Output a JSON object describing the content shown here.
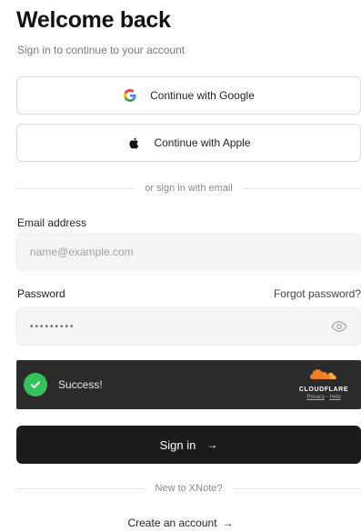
{
  "header": {
    "title": "Welcome back",
    "subtitle": "Sign in to continue to your account"
  },
  "oauth": {
    "google_label": "Continue with Google",
    "apple_label": "Continue with Apple"
  },
  "divider_email": "or sign in with email",
  "email": {
    "label": "Email address",
    "placeholder": "name@example.com",
    "value": ""
  },
  "password": {
    "label": "Password",
    "forgot_label": "Forgot password?",
    "masked_value": "•••••••••"
  },
  "captcha": {
    "status": "Success!",
    "provider": "CLOUDFLARE",
    "privacy": "Privacy",
    "separator": "·",
    "help": "Help",
    "status_color": "#34c25a"
  },
  "signin": {
    "label": "Sign in",
    "arrow": "→"
  },
  "divider_signup": "New to XNote?",
  "create_account": {
    "label": "Create an account",
    "arrow": "→"
  },
  "colors": {
    "primary_button": "#1b1b1b",
    "captcha_bg": "#2b2b2b",
    "cloudflare_orange": "#f38020"
  }
}
